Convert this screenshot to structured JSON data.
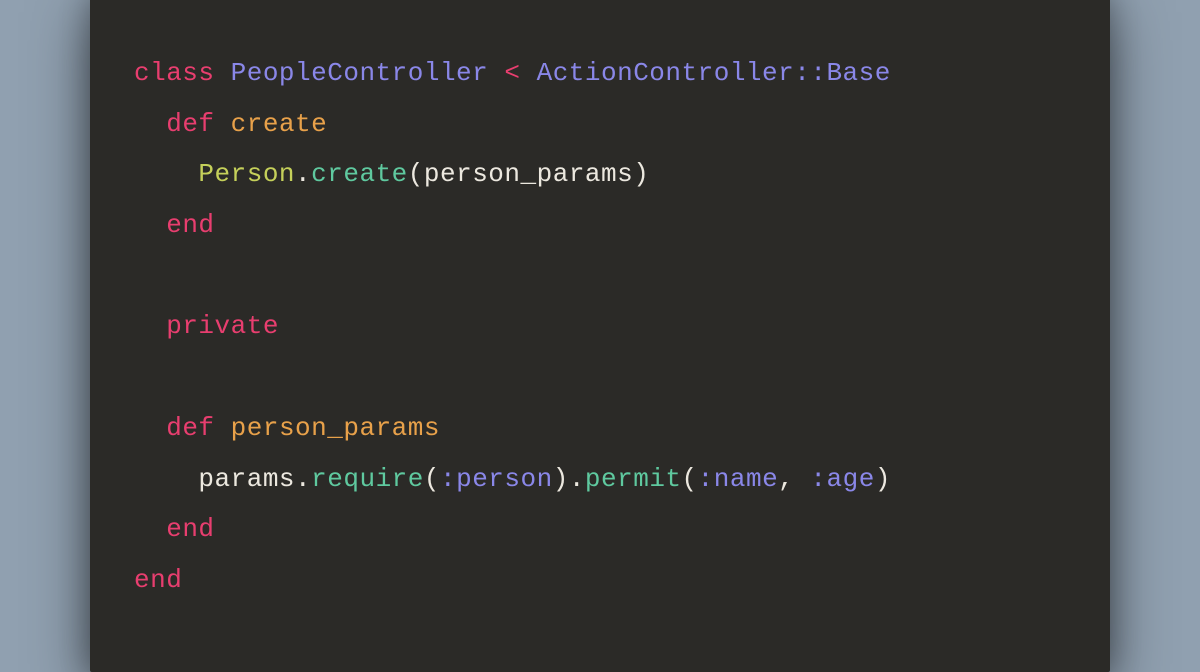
{
  "code": {
    "tokens": {
      "class_kw": "class",
      "class_name": "PeopleController",
      "lt": "<",
      "parent_class": "ActionController::Base",
      "def_kw_1": "def",
      "method_create": "create",
      "const_person": "Person",
      "dot1": ".",
      "call_create": "create",
      "lp1": "(",
      "arg_person_params": "person_params",
      "rp1": ")",
      "end_1": "end",
      "private_kw": "private",
      "def_kw_2": "def",
      "method_person_params": "person_params",
      "params_ident": "params",
      "dot2": ".",
      "call_require": "require",
      "lp2": "(",
      "sym_person": ":person",
      "rp2": ")",
      "dot3": ".",
      "call_permit": "permit",
      "lp3": "(",
      "sym_name": ":name",
      "comma": ",",
      "sym_age": ":age",
      "rp3": ")",
      "end_2": "end",
      "end_3": "end"
    },
    "indent": {
      "i0": "",
      "i1": "  ",
      "i2": "    "
    }
  },
  "colors": {
    "bg_page": "#90a0b0",
    "bg_code": "#2b2a27",
    "keyword_pink": "#e83e6f",
    "class_purple": "#8a87e8",
    "method_orange": "#e8a14a",
    "const_olive": "#c5d05a",
    "call_green": "#5fc99f",
    "plain_cream": "#ece8df",
    "symbol_purple": "#8a87e8"
  }
}
